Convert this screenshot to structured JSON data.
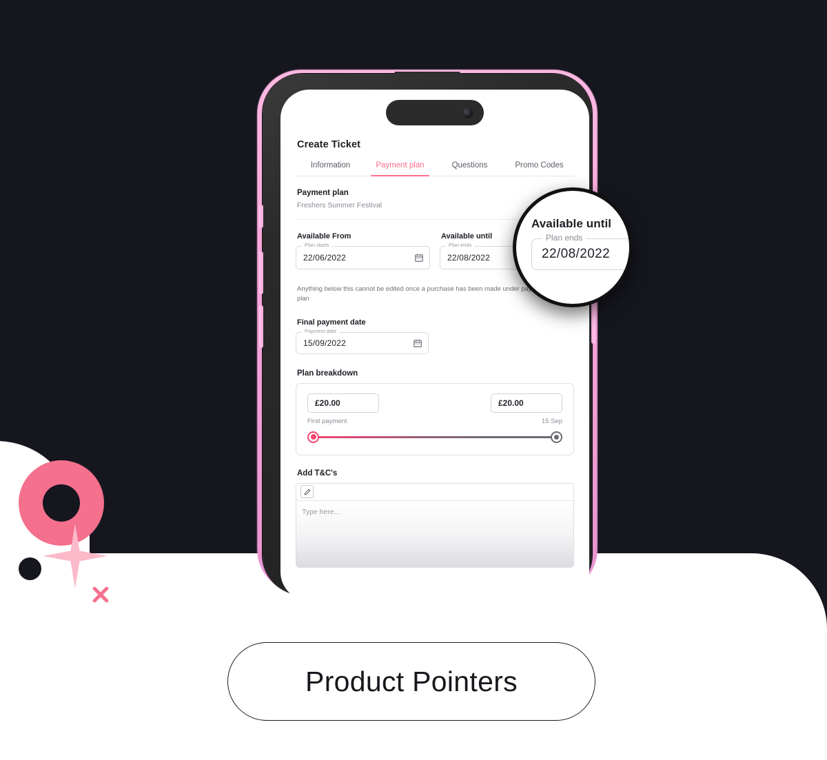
{
  "background": {
    "dark_color": "#16161f",
    "accent_pink": "#F4708D",
    "brand_pink": "#fb6e87"
  },
  "decorations": {
    "donut": "pink-donut-shape",
    "dot": "dark-dot-shape",
    "sparkle": "pink-sparkle-shape",
    "cross": "pink-cross-shape"
  },
  "phone": {
    "frame_color": "#2a2a2a",
    "glow_color": "#ffb9e3",
    "dynamic_island": "dynamic-island",
    "camera": "front-camera"
  },
  "app": {
    "title": "Create Ticket",
    "tabs": [
      {
        "label": "Information",
        "active": false
      },
      {
        "label": "Payment plan",
        "active": true
      },
      {
        "label": "Questions",
        "active": false
      },
      {
        "label": "Promo Codes",
        "active": false
      }
    ],
    "payment_plan": {
      "heading": "Payment plan",
      "name": "Freshers Summer Festival"
    },
    "available_from": {
      "label": "Available From",
      "legend": "Plan starts",
      "value": "22/06/2022",
      "icon": "calendar-icon"
    },
    "available_until": {
      "label": "Available until",
      "legend": "Plan ends",
      "value": "22/08/2022",
      "icon": "calendar-icon"
    },
    "note": "Anything below this cannot be edited once a purchase has been made under payment plan",
    "final_payment_date": {
      "label": "Final payment date",
      "legend": "Payment date",
      "value": "15/09/2022",
      "icon": "calendar-icon"
    },
    "plan_breakdown": {
      "label": "Plan breakdown",
      "first_amount": "£20.00",
      "second_amount": "£20.00",
      "first_caption": "First payment",
      "second_caption": "15 Sep",
      "slider_start_color": "#f4476f",
      "slider_end_color": "#6b6b72"
    },
    "terms": {
      "label": "Add T&C's",
      "edit_icon": "pencil-icon",
      "placeholder": "Type here..."
    }
  },
  "magnifier": {
    "title": "Available until",
    "legend": "Plan ends",
    "value": "22/08/2022"
  },
  "footer": {
    "pill_label": "Product Pointers"
  }
}
